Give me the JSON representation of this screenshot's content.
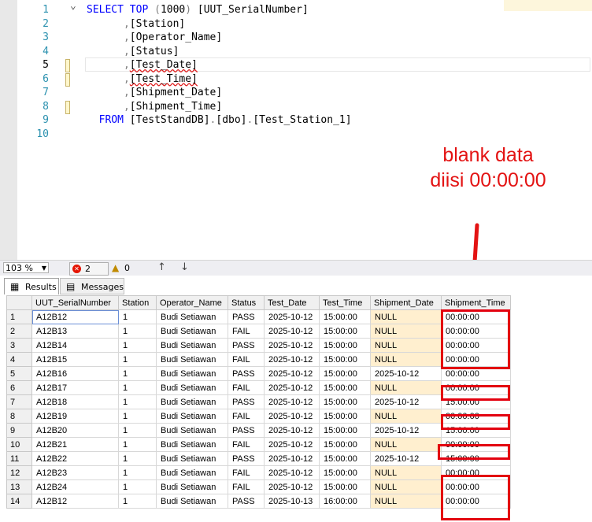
{
  "editor": {
    "lines": [
      {
        "n": "1",
        "segments": [
          {
            "t": "SELECT ",
            "c": "kw"
          },
          {
            "t": "TOP ",
            "c": "kw"
          },
          {
            "t": "(",
            "c": "gr"
          },
          {
            "t": "1000",
            "c": "pl"
          },
          {
            "t": ") ",
            "c": "gr"
          },
          {
            "t": "[UUT_SerialNumber]",
            "c": "pl"
          }
        ]
      },
      {
        "n": "2",
        "segments": [
          {
            "t": "      ,",
            "c": "gr"
          },
          {
            "t": "[Station]",
            "c": "pl"
          }
        ]
      },
      {
        "n": "3",
        "segments": [
          {
            "t": "      ,",
            "c": "gr"
          },
          {
            "t": "[Operator_Name]",
            "c": "pl"
          }
        ]
      },
      {
        "n": "4",
        "segments": [
          {
            "t": "      ,",
            "c": "gr"
          },
          {
            "t": "[Status]",
            "c": "pl"
          }
        ]
      },
      {
        "n": "5",
        "segments": [
          {
            "t": "      ,",
            "c": "gr"
          },
          {
            "t": "[Test_Date]",
            "c": "pl sq"
          }
        ]
      },
      {
        "n": "6",
        "segments": [
          {
            "t": "      ,",
            "c": "gr"
          },
          {
            "t": "[Test_Time]",
            "c": "pl sq"
          }
        ]
      },
      {
        "n": "7",
        "segments": [
          {
            "t": "      ,",
            "c": "gr"
          },
          {
            "t": "[Shipment_Date]",
            "c": "pl"
          }
        ]
      },
      {
        "n": "8",
        "segments": [
          {
            "t": "      ,",
            "c": "gr"
          },
          {
            "t": "[Shipment_Time]",
            "c": "pl"
          }
        ]
      },
      {
        "n": "9",
        "segments": [
          {
            "t": "  FROM ",
            "c": "kw"
          },
          {
            "t": "[TestStandDB]",
            "c": "pl"
          },
          {
            "t": ".",
            "c": "gr"
          },
          {
            "t": "[dbo]",
            "c": "pl"
          },
          {
            "t": ".",
            "c": "gr"
          },
          {
            "t": "[Test_Station_1]",
            "c": "pl"
          }
        ]
      },
      {
        "n": "10",
        "segments": []
      }
    ]
  },
  "annotation": {
    "line1": "blank data",
    "line2": "diisi 00:00:00",
    "color": "#e31313"
  },
  "status": {
    "zoom": "103 %",
    "errors": "2",
    "warnings": "0"
  },
  "tabs": {
    "results": "Results",
    "messages": "Messages"
  },
  "grid": {
    "columns": [
      "UUT_SerialNumber",
      "Station",
      "Operator_Name",
      "Status",
      "Test_Date",
      "Test_Time",
      "Shipment_Date",
      "Shipment_Time"
    ],
    "rows": [
      [
        "1",
        "A12B12",
        "1",
        "Budi Setiawan",
        "PASS",
        "2025-10-12",
        "15:00:00",
        "NULL",
        "00:00:00"
      ],
      [
        "2",
        "A12B13",
        "1",
        "Budi Setiawan",
        "FAIL",
        "2025-10-12",
        "15:00:00",
        "NULL",
        "00:00:00"
      ],
      [
        "3",
        "A12B14",
        "1",
        "Budi Setiawan",
        "PASS",
        "2025-10-12",
        "15:00:00",
        "NULL",
        "00:00:00"
      ],
      [
        "4",
        "A12B15",
        "1",
        "Budi Setiawan",
        "FAIL",
        "2025-10-12",
        "15:00:00",
        "NULL",
        "00:00:00"
      ],
      [
        "5",
        "A12B16",
        "1",
        "Budi Setiawan",
        "PASS",
        "2025-10-12",
        "15:00:00",
        "2025-10-12",
        "00:00:00"
      ],
      [
        "6",
        "A12B17",
        "1",
        "Budi Setiawan",
        "FAIL",
        "2025-10-12",
        "15:00:00",
        "NULL",
        "00:00:00"
      ],
      [
        "7",
        "A12B18",
        "1",
        "Budi Setiawan",
        "PASS",
        "2025-10-12",
        "15:00:00",
        "2025-10-12",
        "15:00:00"
      ],
      [
        "8",
        "A12B19",
        "1",
        "Budi Setiawan",
        "FAIL",
        "2025-10-12",
        "15:00:00",
        "NULL",
        "00:00:00"
      ],
      [
        "9",
        "A12B20",
        "1",
        "Budi Setiawan",
        "PASS",
        "2025-10-12",
        "15:00:00",
        "2025-10-12",
        "15:00:00"
      ],
      [
        "10",
        "A12B21",
        "1",
        "Budi Setiawan",
        "FAIL",
        "2025-10-12",
        "15:00:00",
        "NULL",
        "00:00:00"
      ],
      [
        "11",
        "A12B22",
        "1",
        "Budi Setiawan",
        "PASS",
        "2025-10-12",
        "15:00:00",
        "2025-10-12",
        "15:00:00"
      ],
      [
        "12",
        "A12B23",
        "1",
        "Budi Setiawan",
        "FAIL",
        "2025-10-12",
        "15:00:00",
        "NULL",
        "00:00:00"
      ],
      [
        "13",
        "A12B24",
        "1",
        "Budi Setiawan",
        "FAIL",
        "2025-10-12",
        "15:00:00",
        "NULL",
        "00:00:00"
      ],
      [
        "14",
        "A12B12",
        "1",
        "Budi Setiawan",
        "PASS",
        "2025-10-13",
        "16:00:00",
        "NULL",
        "00:00:00"
      ]
    ]
  }
}
